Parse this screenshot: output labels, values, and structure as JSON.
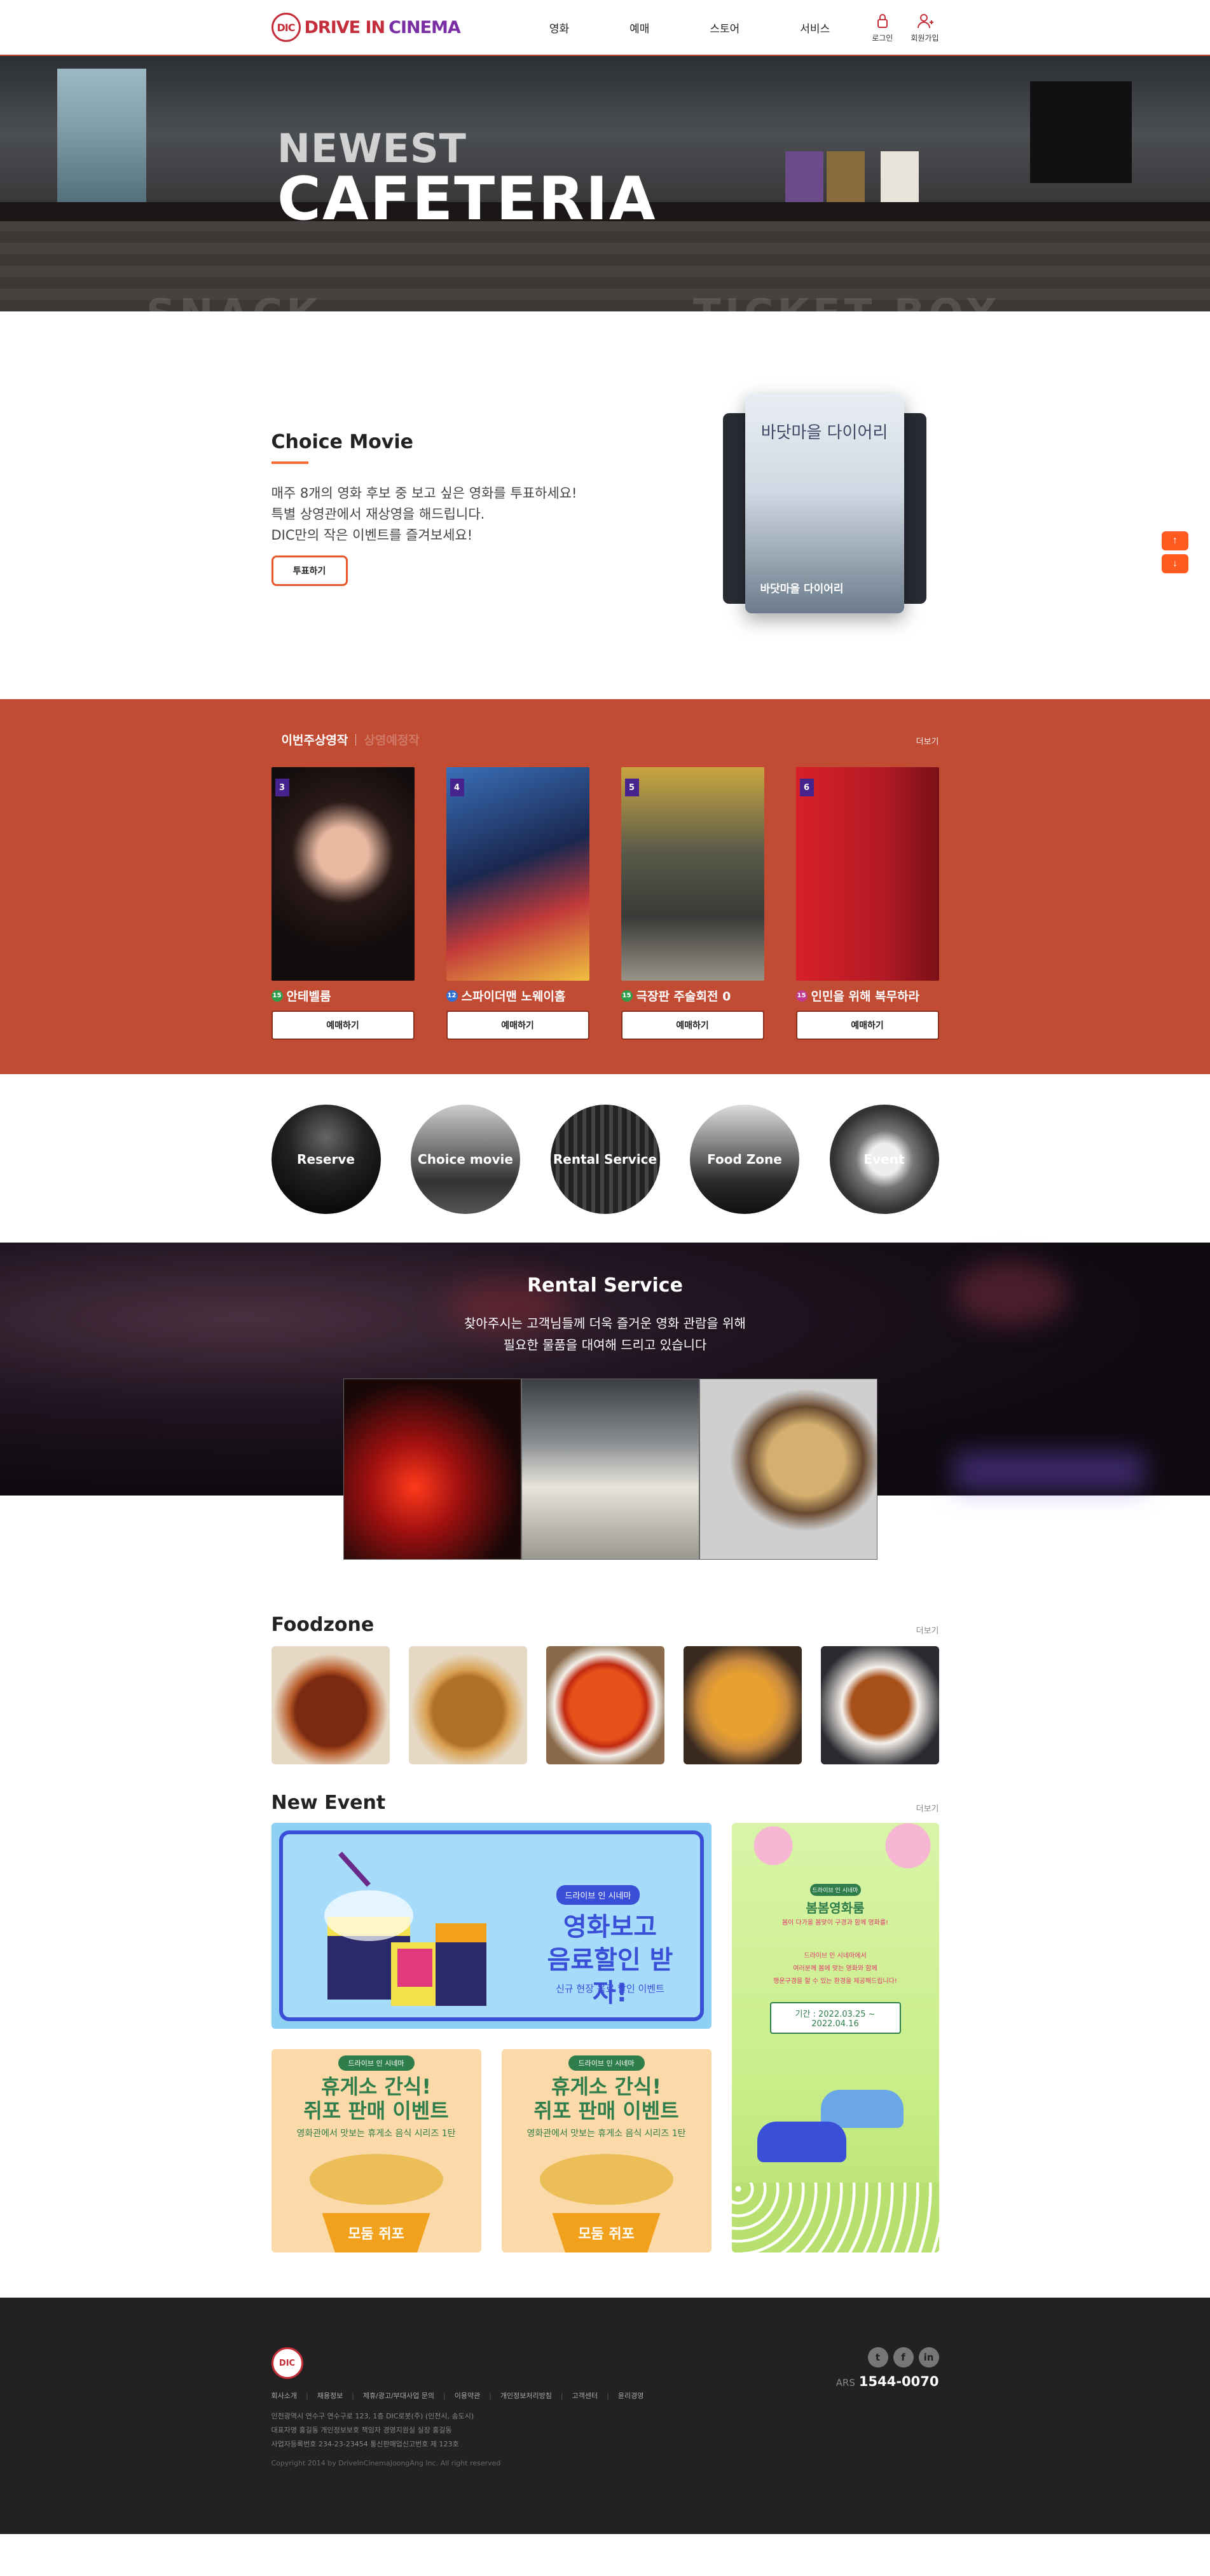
{
  "header": {
    "logo_mark": "DIC",
    "logo_drive": "DRIVE IN ",
    "logo_cinema": "CINEMA",
    "nav": [
      "영화",
      "예매",
      "스토어",
      "서비스"
    ],
    "login": "로그인",
    "signup": "회원가입"
  },
  "hero": {
    "line1": "NEWEST",
    "line2": "CAFETERIA",
    "bg_text_left": "SNACK",
    "bg_text_right": "TICKET BOX"
  },
  "choice": {
    "title": "Choice Movie",
    "desc": [
      "매주 8개의 영화 후보 중 보고 싶은 영화를 투표하세요!",
      "특별 상영관에서 재상영을 해드립니다.",
      "DIC만의 작은 이벤트를 즐겨보세요!"
    ],
    "vote_button": "투표하기",
    "card_poster_title": "바닷마을 다이어리",
    "card_caption": "바닷마을 다이어리"
  },
  "quick": {
    "up": "↑",
    "down": "↓"
  },
  "showing": {
    "tab_active": "이번주상영작",
    "tab_inactive": "상영예정작",
    "more": "더보기",
    "reserve_label": "예매하기",
    "movies": [
      {
        "rank": "3",
        "age": "15",
        "age_color": "#2e9e4a",
        "title": "안테벨룸"
      },
      {
        "rank": "4",
        "age": "12",
        "age_color": "#2f6fd1",
        "title": "스파이더맨 노웨이홈"
      },
      {
        "rank": "5",
        "age": "15",
        "age_color": "#2e9e4a",
        "title": "극장판 주술회전 0"
      },
      {
        "rank": "6",
        "age": "15",
        "age_color": "#c23a8f",
        "title": "인민을 위해 복무하라"
      }
    ]
  },
  "circles": [
    "Reserve",
    "Choice movie",
    "Rental Service",
    "Food Zone",
    "Event"
  ],
  "rental": {
    "title": "Rental Service",
    "desc": [
      "찾아주시는 고객님들께 더욱 즐거운 영화 관람을 위해",
      "필요한 물품을 대여해 드리고 있습니다"
    ]
  },
  "food": {
    "title": "Foodzone",
    "more": "더보기"
  },
  "events": {
    "title": "New Event",
    "more": "더보기",
    "big": {
      "tag": "드라이브 인 시네마",
      "line1": "영화보고",
      "line2": "음료할인 받자!",
      "sub": "신규 현장 음료 할인 이벤트"
    },
    "small": {
      "tag": "드라이브 인 시네마",
      "line1": "휴게소 간식!",
      "line2": "쥐포 판매 이벤트",
      "sub": "영화관에서 맛보는 휴게소 음식 시리즈 1탄",
      "pot": "모둠 쥐포"
    },
    "tall": {
      "tag": "드라이브 인 시네마",
      "title": "봄봄영화룸",
      "sub": "봄이 다가올 봄맞이 구경과 함께 영화를!",
      "body": [
        "드라이브 인 시네마에서",
        "여러분께 봄에 맞는 영화와 함께",
        "행운구경을 할 수 있는 환경을 제공해드립니다!"
      ],
      "date": "기간 : 2022.03.25 ~ 2022.04.16"
    }
  },
  "footer": {
    "logo": "DIC",
    "menu": [
      "회사소개",
      "채용정보",
      "제휴/광고/부대사업 문의",
      "이용약관",
      "개인정보처리방침",
      "고객센터",
      "윤리경영"
    ],
    "info": [
      "인천광역시 연수구 연수구로 123, 1층 DIC로봇(주) (인천시, 송도시)",
      "대표자명 홍길동 개인정보보호 책임자 경영지원실 실장 홍길동",
      "사업자등록번호 234-23-23454 통신판매업신고번호 제 123호"
    ],
    "copyright": "Copyright 2014 by DriveInCinemaJoongAng Inc. All right reserved",
    "ars_label": "ARS",
    "ars_number": "1544-0070",
    "sns": [
      "t",
      "f",
      "in"
    ]
  }
}
